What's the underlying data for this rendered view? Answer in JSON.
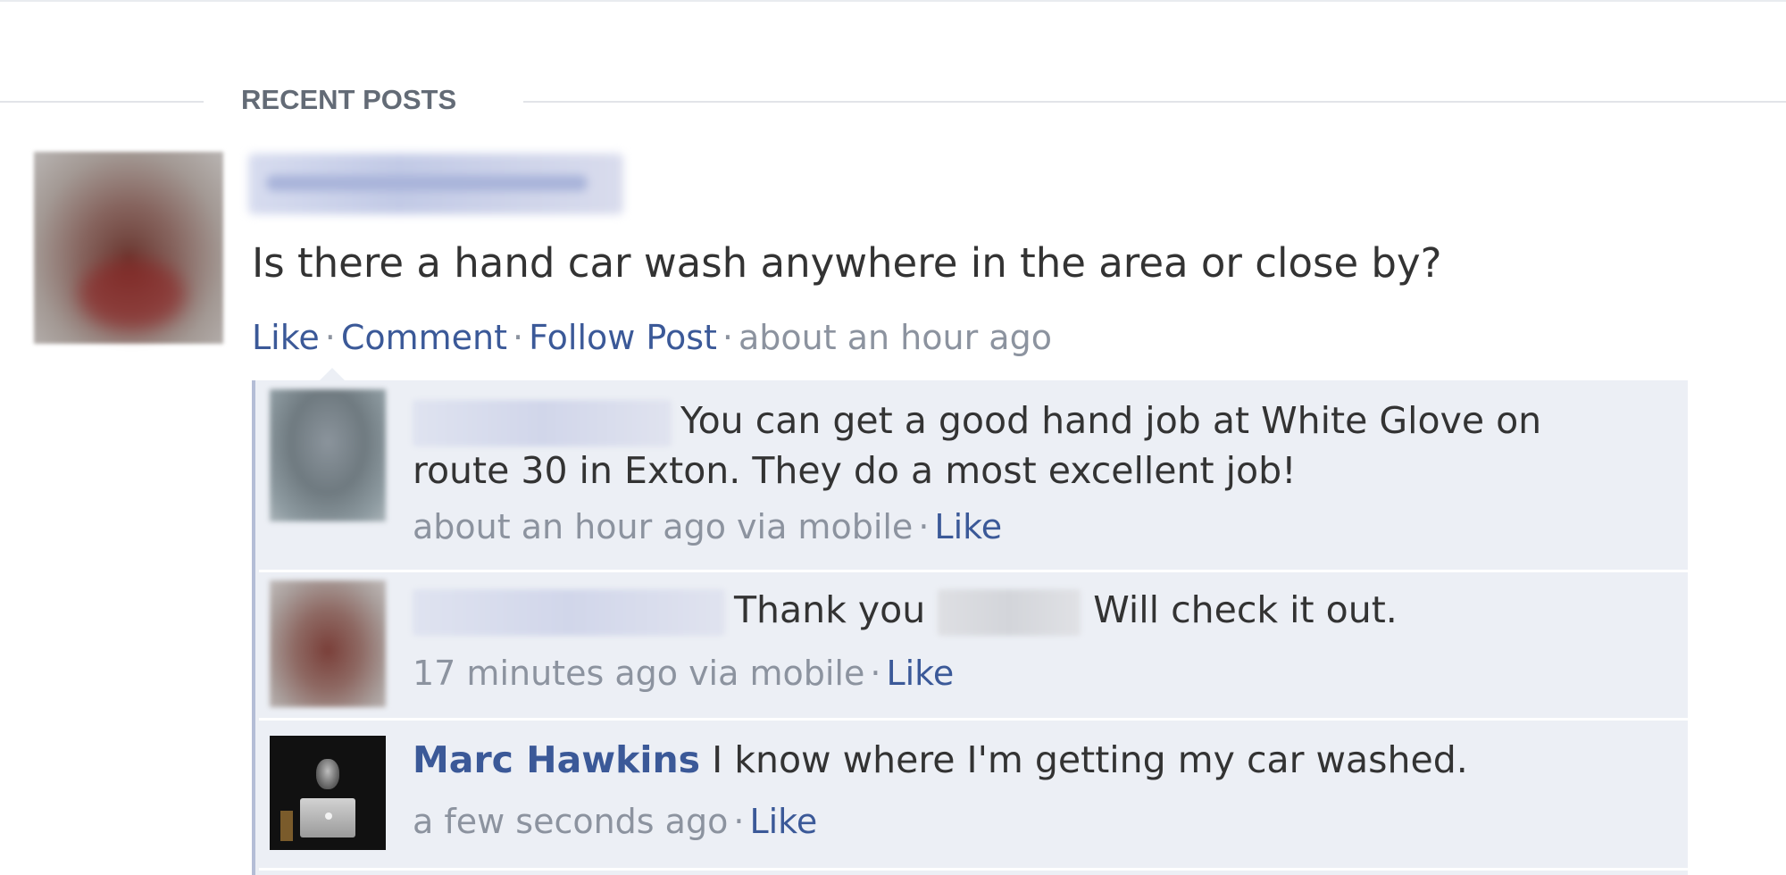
{
  "section": {
    "title": "RECENT POSTS"
  },
  "post": {
    "text": "Is there a hand car wash anywhere in the area or close by?",
    "actions": {
      "like": "Like",
      "comment": "Comment",
      "follow": "Follow Post",
      "time": "about an hour ago"
    },
    "separator": "·"
  },
  "comments": [
    {
      "line1": "You can get a good hand job at White Glove on",
      "line2": "route 30 in Exton. They do a most excellent job!",
      "meta": "about an hour ago via mobile",
      "like": "Like"
    },
    {
      "text_before": "Thank you",
      "text_after": "Will check it out.",
      "meta": "17 minutes ago via mobile",
      "like": "Like"
    },
    {
      "author": "Marc Hawkins",
      "text": "I know where I'm getting my car washed.",
      "meta": "a few seconds ago",
      "like": "Like"
    }
  ],
  "colors": {
    "link": "#3b5998",
    "meta": "#8c939f",
    "comment_bg": "#eceff5"
  }
}
